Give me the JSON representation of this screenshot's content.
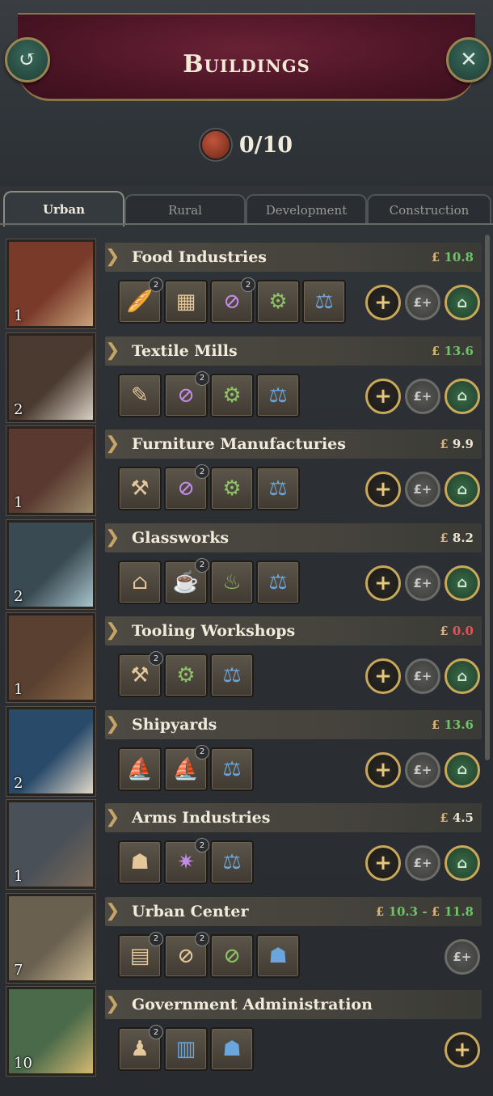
{
  "header": {
    "title": "Buildings",
    "counter": "0/10"
  },
  "tabs": [
    {
      "label": "Urban",
      "active": true
    },
    {
      "label": "Rural",
      "active": false
    },
    {
      "label": "Development",
      "active": false
    },
    {
      "label": "Construction",
      "active": false
    }
  ],
  "buildings": [
    {
      "name": "Food Industries",
      "level": "1",
      "money": "10.8",
      "money_low": null,
      "money_tone": "pos",
      "mods": [
        {
          "icon": "bread-icon",
          "glyph": "🥖",
          "badge": "2",
          "tone": "tan"
        },
        {
          "icon": "canning-icon",
          "glyph": "▦",
          "badge": null,
          "tone": "tan"
        },
        {
          "icon": "no-distillery-icon",
          "glyph": "⊘",
          "badge": "2",
          "tone": "purple"
        },
        {
          "icon": "no-automation-icon",
          "glyph": "⚙",
          "badge": null,
          "tone": "green"
        },
        {
          "icon": "ownership-scales-icon",
          "glyph": "⚖",
          "badge": null,
          "tone": "blue"
        }
      ],
      "actions": [
        "add",
        "econ",
        "house"
      ]
    },
    {
      "name": "Textile Mills",
      "level": "2",
      "money": "13.6",
      "money_low": null,
      "money_tone": "pos",
      "mods": [
        {
          "icon": "handsewn-clothes-icon",
          "glyph": "✎",
          "badge": null,
          "tone": "tan"
        },
        {
          "icon": "no-luxury-clothes-icon",
          "glyph": "⊘",
          "badge": "2",
          "tone": "purple"
        },
        {
          "icon": "no-automation-icon",
          "glyph": "⚙",
          "badge": null,
          "tone": "green"
        },
        {
          "icon": "ownership-scales-icon",
          "glyph": "⚖",
          "badge": null,
          "tone": "blue"
        }
      ],
      "actions": [
        "add",
        "econ",
        "house"
      ]
    },
    {
      "name": "Furniture Manufacturies",
      "level": "1",
      "money": "9.9",
      "money_low": null,
      "money_tone": "neu",
      "mods": [
        {
          "icon": "handcrafted-furniture-icon",
          "glyph": "⚒",
          "badge": null,
          "tone": "tan"
        },
        {
          "icon": "no-luxury-furniture-icon",
          "glyph": "⊘",
          "badge": "2",
          "tone": "purple"
        },
        {
          "icon": "no-automation-icon",
          "glyph": "⚙",
          "badge": null,
          "tone": "green"
        },
        {
          "icon": "ownership-scales-icon",
          "glyph": "⚖",
          "badge": null,
          "tone": "blue"
        }
      ],
      "actions": [
        "add",
        "econ",
        "house"
      ]
    },
    {
      "name": "Glassworks",
      "level": "2",
      "money": "8.2",
      "money_low": null,
      "money_tone": "neu",
      "mods": [
        {
          "icon": "forest-glass-icon",
          "glyph": "⌂",
          "badge": null,
          "tone": "tan"
        },
        {
          "icon": "ceramics-teapot-icon",
          "glyph": "☕",
          "badge": "2",
          "tone": "purple"
        },
        {
          "icon": "manual-glassblowing-icon",
          "glyph": "♨",
          "badge": null,
          "tone": "green"
        },
        {
          "icon": "ownership-scales-icon",
          "glyph": "⚖",
          "badge": null,
          "tone": "blue"
        }
      ],
      "actions": [
        "add",
        "econ",
        "house"
      ]
    },
    {
      "name": "Tooling Workshops",
      "level": "1",
      "money": "0.0",
      "money_low": null,
      "money_tone": "neg",
      "mods": [
        {
          "icon": "crude-tools-icon",
          "glyph": "⚒",
          "badge": "2",
          "tone": "tan"
        },
        {
          "icon": "no-automation-icon",
          "glyph": "⚙",
          "badge": null,
          "tone": "green"
        },
        {
          "icon": "ownership-scales-icon",
          "glyph": "⚖",
          "badge": null,
          "tone": "blue"
        }
      ],
      "actions": [
        "add",
        "econ",
        "house"
      ]
    },
    {
      "name": "Shipyards",
      "level": "2",
      "money": "13.6",
      "money_low": null,
      "money_tone": "pos",
      "mods": [
        {
          "icon": "wooden-ships-icon",
          "glyph": "⛵",
          "badge": null,
          "tone": "tan"
        },
        {
          "icon": "military-ships-icon",
          "glyph": "⛵",
          "badge": "2",
          "tone": "purple"
        },
        {
          "icon": "ownership-scales-icon",
          "glyph": "⚖",
          "badge": null,
          "tone": "blue"
        }
      ],
      "actions": [
        "add",
        "econ",
        "house"
      ]
    },
    {
      "name": "Arms Industries",
      "level": "1",
      "money": "4.5",
      "money_low": null,
      "money_tone": "neu",
      "mods": [
        {
          "icon": "muskets-icon",
          "glyph": "☗",
          "badge": null,
          "tone": "tan"
        },
        {
          "icon": "cannons-icon",
          "glyph": "✷",
          "badge": "2",
          "tone": "purple"
        },
        {
          "icon": "ownership-scales-icon",
          "glyph": "⚖",
          "badge": null,
          "tone": "blue"
        }
      ],
      "actions": [
        "add",
        "econ",
        "house"
      ]
    },
    {
      "name": "Urban Center",
      "level": "7",
      "money": "11.8",
      "money_low": "10.3",
      "money_tone": "pos",
      "mods": [
        {
          "icon": "market-stalls-icon",
          "glyph": "▤",
          "badge": "2",
          "tone": "tan"
        },
        {
          "icon": "street-lighting-icon",
          "glyph": "⊘",
          "badge": "2",
          "tone": "tan"
        },
        {
          "icon": "no-public-transport-icon",
          "glyph": "⊘",
          "badge": null,
          "tone": "green"
        },
        {
          "icon": "ownership-hands-icon",
          "glyph": "☗",
          "badge": null,
          "tone": "blue"
        }
      ],
      "actions": [
        "econ"
      ]
    },
    {
      "name": "Government Administration",
      "level": "10",
      "money": null,
      "money_low": null,
      "money_tone": "neu",
      "mods": [
        {
          "icon": "administrators-icon",
          "glyph": "♟",
          "badge": "2",
          "tone": "tan"
        },
        {
          "icon": "bureaucrats-icon",
          "glyph": "▥",
          "badge": null,
          "tone": "blue"
        },
        {
          "icon": "ownership-hands-icon",
          "glyph": "☗",
          "badge": null,
          "tone": "blue"
        }
      ],
      "actions": [
        "add"
      ]
    }
  ],
  "labels": {
    "currency": "£",
    "add": "+",
    "econ": "£+",
    "house": "⌂"
  },
  "colors": {
    "banner": "#4c1526",
    "gold": "#c9a85c",
    "positive": "#6fc46a",
    "negative": "#e0555a"
  }
}
